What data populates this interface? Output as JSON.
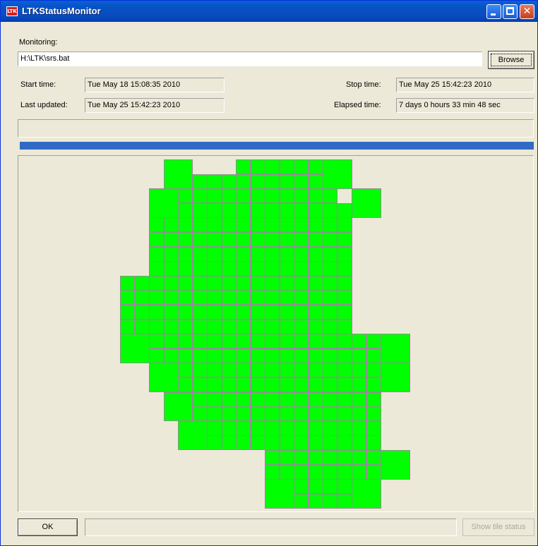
{
  "window": {
    "title": "LTKStatusMonitor",
    "icon": "ltk-app-icon",
    "icon_text": "LTK",
    "close_glyph": "✕"
  },
  "monitoring": {
    "label": "Monitoring:",
    "path": "H:\\LTK\\srs.bat",
    "browse_label": "Browse"
  },
  "times": {
    "start_label": "Start time:",
    "start_value": "Tue May 18 15:08:35 2010",
    "stop_label": "Stop time:",
    "stop_value": "Tue May 25 15:42:23 2010",
    "updated_label": "Last updated:",
    "updated_value": "Tue May 25 15:42:23 2010",
    "elapsed_label": "Elapsed time:",
    "elapsed_value": "7 days 0 hours 33 min 48 sec"
  },
  "progress": {
    "status_text": "",
    "fraction": 1.0
  },
  "tiles": {
    "status": "complete",
    "color": "#00ff00"
  },
  "footer": {
    "ok_label": "OK",
    "status_text": "",
    "show_tile_status_label": "Show tile status"
  },
  "colors": {
    "tile_complete": "#00ff00",
    "progress": "#316ac5",
    "titlebar": "#0653c4"
  }
}
